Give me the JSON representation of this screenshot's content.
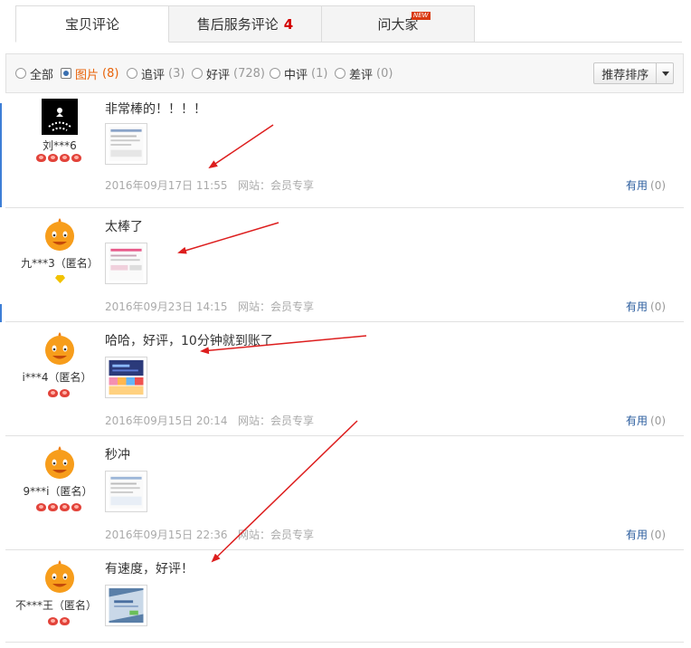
{
  "tabs": [
    {
      "label": "宝贝评论",
      "count": "",
      "badge": "",
      "active": true
    },
    {
      "label": "售后服务评论",
      "count": "4",
      "badge": ""
    },
    {
      "label": "问大家",
      "count": "",
      "badge": "NEW"
    }
  ],
  "filters": [
    {
      "label": "全部",
      "count": ""
    },
    {
      "label": "图片",
      "count": "(8)"
    },
    {
      "label": "追评",
      "count": "(3)"
    },
    {
      "label": "好评",
      "count": "(728)"
    },
    {
      "label": "中评",
      "count": "(1)"
    },
    {
      "label": "差评",
      "count": "(0)"
    }
  ],
  "sort_label": "推荐排序",
  "reviews": [
    {
      "user": "刘***6",
      "avatar": "dark-avatar",
      "rank": "hearts-4",
      "text": "非常棒的！！！！",
      "date": "2016年09月17日 11:55",
      "site": "网站：会员专享",
      "useful": "有用",
      "useful_count": "(0)"
    },
    {
      "user": "九***3（匿名）",
      "avatar": "orange-avatar",
      "rank": "diamond-1",
      "text": "太棒了",
      "date": "2016年09月23日 14:15",
      "site": "网站：会员专享",
      "useful": "有用",
      "useful_count": "(0)"
    },
    {
      "user": "i***4（匿名）",
      "avatar": "orange-avatar",
      "rank": "hearts-2",
      "text": "哈哈，好评，10分钟就到账了",
      "date": "2016年09月15日 20:14",
      "site": "网站：会员专享",
      "useful": "有用",
      "useful_count": "(0)"
    },
    {
      "user": "9***i（匿名）",
      "avatar": "orange-avatar",
      "rank": "hearts-4",
      "text": "秒冲",
      "date": "2016年09月15日 22:36",
      "site": "网站：会员专享",
      "useful": "有用",
      "useful_count": "(0)"
    },
    {
      "user": "不***王（匿名）",
      "avatar": "orange-avatar",
      "rank": "hearts-2",
      "text": "有速度，好评！",
      "date": "",
      "site": "",
      "useful": "",
      "useful_count": ""
    }
  ],
  "colors": {
    "accent_blue": "#2a5c9e",
    "red_arrow": "#dd1e1e",
    "selected_orange": "#e8630a",
    "tab_count_red": "#d40000"
  }
}
